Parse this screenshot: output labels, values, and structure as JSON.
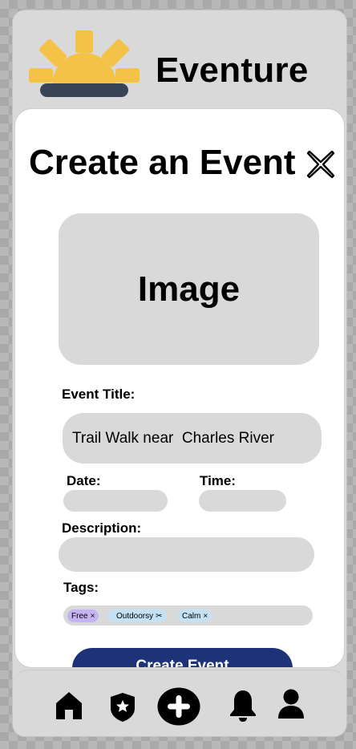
{
  "app": {
    "name": "Eventure"
  },
  "form": {
    "heading": "Create an Event",
    "image_placeholder": "Image",
    "event_title_label": "Event Title:",
    "event_title_value": "Trail Walk near  Charles River",
    "date_label": "Date:",
    "date_value": "",
    "time_label": "Time:",
    "time_value": "",
    "description_label": "Description:",
    "description_value": "",
    "tags_label": "Tags:",
    "tags": [
      {
        "label": "Free",
        "remove": "×",
        "color": "#c6b3f2"
      },
      {
        "label": "Outdoorsy",
        "remove": "✂",
        "color": "#c4e2f3"
      },
      {
        "label": "Calm",
        "remove": "×",
        "color": "#c4e2f3"
      }
    ],
    "submit_label": "Create Event"
  },
  "nav": {
    "items": [
      "home-icon",
      "badge-icon",
      "add-icon",
      "bell-icon",
      "profile-icon"
    ]
  },
  "colors": {
    "accent": "#1e3377",
    "sun": "#f4c247",
    "horizon": "#3a4457",
    "surface": "#d9d9d9"
  }
}
